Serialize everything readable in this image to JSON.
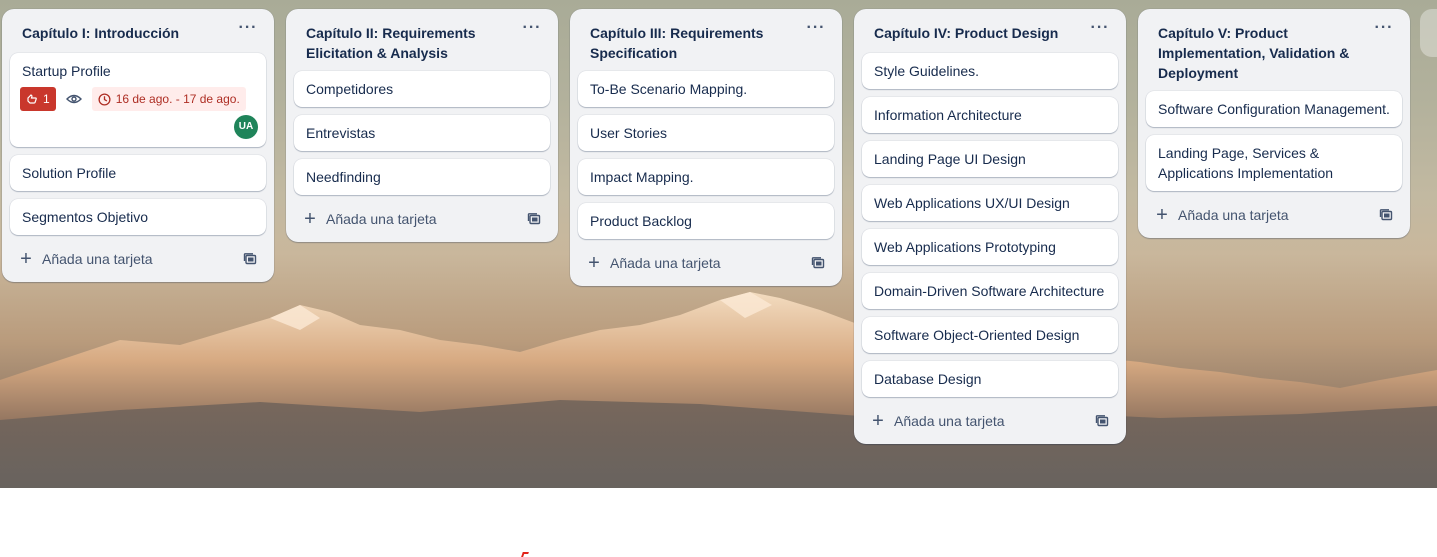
{
  "board": {
    "lists": [
      {
        "title": "Capítulo I: Introducción",
        "cards": [
          {
            "title": "Startup Profile",
            "votes": "1",
            "date": "16 de ago. - 17 de ago.",
            "member": "UA"
          },
          {
            "title": "Solution Profile"
          },
          {
            "title": "Segmentos Objetivo"
          }
        ],
        "add_label": "Añada una tarjeta"
      },
      {
        "title": "Capítulo II: Requirements Elicitation & Analysis",
        "cards": [
          {
            "title": "Competidores"
          },
          {
            "title": "Entrevistas"
          },
          {
            "title": "Needfinding"
          }
        ],
        "add_label": "Añada una tarjeta"
      },
      {
        "title": "Capítulo III: Requirements Specification",
        "cards": [
          {
            "title": "To-Be Scenario Mapping."
          },
          {
            "title": "User Stories"
          },
          {
            "title": "Impact Mapping."
          },
          {
            "title": "Product Backlog"
          }
        ],
        "add_label": "Añada una tarjeta"
      },
      {
        "title": "Capítulo IV: Product Design",
        "cards": [
          {
            "title": "Style Guidelines."
          },
          {
            "title": "Information Architecture"
          },
          {
            "title": "Landing Page UI Design"
          },
          {
            "title": "Web Applications UX/UI Design"
          },
          {
            "title": "Web Applications Prototyping"
          },
          {
            "title": "Domain-Driven Software Architecture"
          },
          {
            "title": "Software Object-Oriented Design"
          },
          {
            "title": "Database Design"
          }
        ],
        "add_label": "Añada una tarjeta"
      },
      {
        "title": "Capítulo V: Product Implementation, Validation & Deployment",
        "cards": [
          {
            "title": "Software Configuration Management."
          },
          {
            "title": "Landing Page, Services & Applications Implementation"
          }
        ],
        "add_label": "Añada una tarjeta"
      }
    ],
    "menu_glyph": "···"
  },
  "colors": {
    "list_bg": "#f1f2f4",
    "vote_badge": "#c9372c",
    "date_badge_bg": "#ffeceb",
    "date_badge_text": "#ae2e24",
    "avatar": "#1f845a"
  },
  "icons": [
    "list-menu-icon",
    "vote-icon",
    "watch-eye-icon",
    "clock-icon",
    "plus-icon",
    "create-from-template-icon"
  ]
}
